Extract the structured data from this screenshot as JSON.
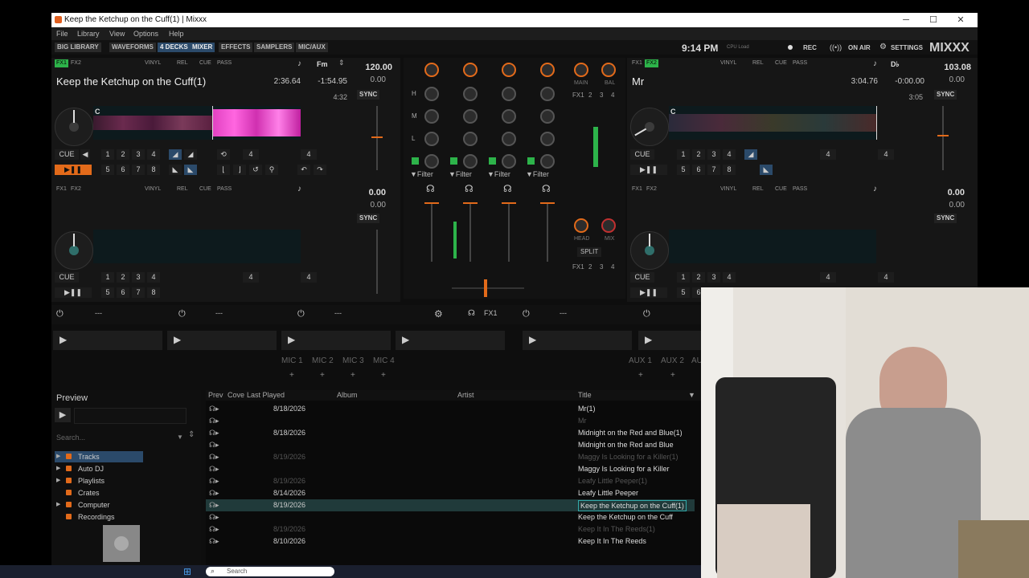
{
  "window": {
    "title": "Keep the Ketchup on the Cuff(1) | Mixxx",
    "min": "─",
    "max": "☐",
    "close": "✕"
  },
  "menu": [
    "File",
    "Library",
    "View",
    "Options",
    "Help"
  ],
  "topbar": {
    "buttons": [
      "BIG LIBRARY",
      "WAVEFORMS",
      "4 DECKS",
      "MIXER",
      "EFFECTS",
      "SAMPLERS",
      "MIC/AUX"
    ],
    "clock": "9:14 PM",
    "cpu_label": "CPU Load",
    "rec": "REC",
    "on_air": "ON AIR",
    "settings": "SETTINGS",
    "logo": "MIXXX"
  },
  "deck1": {
    "fx1": "FX1",
    "fx2": "FX2",
    "vinyl": "VINYL",
    "rel": "REL",
    "cue": "CUE",
    "pass": "PASS",
    "key": "Fm",
    "bpm": "120.00",
    "rate": "0.00",
    "title": "Keep the Ketchup on the Cuff(1)",
    "elapsed": "2:36.64",
    "remaining": "-1:54.95",
    "duration": "4:32",
    "sync": "SYNC",
    "marker": "C",
    "cue_btn": "CUE",
    "hotcues_top": [
      "1",
      "2",
      "3",
      "4"
    ],
    "hotcues_bottom": [
      "5",
      "6",
      "7",
      "8"
    ],
    "loop": "4",
    "beatjump": "4"
  },
  "deck2": {
    "fx1": "FX1",
    "fx2": "FX2",
    "vinyl": "VINYL",
    "rel": "REL",
    "cue": "CUE",
    "pass": "PASS",
    "key": "D♭",
    "bpm": "103.08",
    "rate": "0.00",
    "title": "Mr",
    "elapsed": "3:04.76",
    "remaining": "-0:00.00",
    "duration": "3:05",
    "sync": "SYNC",
    "marker": "C",
    "cue_btn": "CUE",
    "hotcues_top": [
      "1",
      "2",
      "3",
      "4"
    ],
    "hotcues_bottom": [
      "5",
      "6",
      "7",
      "8"
    ],
    "loop": "4",
    "beatjump": "4"
  },
  "deck3": {
    "fx1": "FX1",
    "fx2": "FX2",
    "vinyl": "VINYL",
    "rel": "REL",
    "cue": "CUE",
    "pass": "PASS",
    "bpm": "0.00",
    "rate": "0.00",
    "sync": "SYNC",
    "cue_btn": "CUE",
    "hotcues_top": [
      "1",
      "2",
      "3",
      "4"
    ],
    "hotcues_bottom": [
      "5",
      "6",
      "7",
      "8"
    ],
    "loop": "4",
    "beatjump": "4"
  },
  "deck4": {
    "fx1": "FX1",
    "fx2": "FX2",
    "vinyl": "VINYL",
    "rel": "REL",
    "cue": "CUE",
    "pass": "PASS",
    "bpm": "0.00",
    "rate": "0.00",
    "sync": "SYNC",
    "cue_btn": "CUE",
    "hotcues_top": [
      "1",
      "2",
      "3",
      "4"
    ],
    "hotcues_bottom": [
      "5",
      "6"
    ],
    "loop": "4",
    "beatjump": "4"
  },
  "mixer": {
    "eq": [
      "H",
      "M",
      "L"
    ],
    "filter": "▼Filter",
    "main": "MAIN",
    "bal": "BAL",
    "head": "HEAD",
    "mix": "MIX",
    "split": "SPLIT",
    "fx_row": [
      "FX1",
      "2",
      "3",
      "4"
    ]
  },
  "fx_units": {
    "preset": "---",
    "fx_label": "FX1"
  },
  "mic_aux": {
    "mics": [
      "MIC 1",
      "MIC 2",
      "MIC 3",
      "MIC 4"
    ],
    "aux": [
      "AUX 1",
      "AUX 2",
      "AU"
    ],
    "plus": "+"
  },
  "preview": {
    "label": "Preview",
    "search_placeholder": "Search..."
  },
  "sidebar": [
    "Tracks",
    "Auto DJ",
    "Playlists",
    "Crates",
    "Computer",
    "Recordings"
  ],
  "library": {
    "columns": [
      "Prev",
      "Cove",
      "Last Played",
      "Album",
      "Artist",
      "Title"
    ],
    "rows": [
      {
        "played": "8/18/2026",
        "title": "Mr(1)",
        "dim": false,
        "sel": false
      },
      {
        "played": "",
        "title": "Mr",
        "dim": true,
        "sel": false
      },
      {
        "played": "8/18/2026",
        "title": "Midnight on the Red and Blue(1)",
        "dim": false,
        "sel": false
      },
      {
        "played": "",
        "title": "Midnight on the Red and Blue",
        "dim": false,
        "sel": false
      },
      {
        "played": "8/19/2026",
        "title": "Maggy Is Looking for a Killer(1)",
        "dim": true,
        "sel": false
      },
      {
        "played": "",
        "title": "Maggy Is Looking for a Killer",
        "dim": false,
        "sel": false
      },
      {
        "played": "8/19/2026",
        "title": "Leafy Little Peeper(1)",
        "dim": true,
        "sel": false
      },
      {
        "played": "8/14/2026",
        "title": "Leafy Little Peeper",
        "dim": false,
        "sel": false
      },
      {
        "played": "8/19/2026",
        "title": "Keep the Ketchup on the Cuff(1)",
        "dim": false,
        "sel": true
      },
      {
        "played": "",
        "title": "Keep the Ketchup on the Cuff",
        "dim": false,
        "sel": false
      },
      {
        "played": "8/19/2026",
        "title": "Keep It In The Reeds(1)",
        "dim": true,
        "sel": false
      },
      {
        "played": "8/10/2026",
        "title": "Keep It In The Reeds",
        "dim": false,
        "sel": false
      }
    ]
  },
  "taskbar": {
    "search": "Search"
  }
}
